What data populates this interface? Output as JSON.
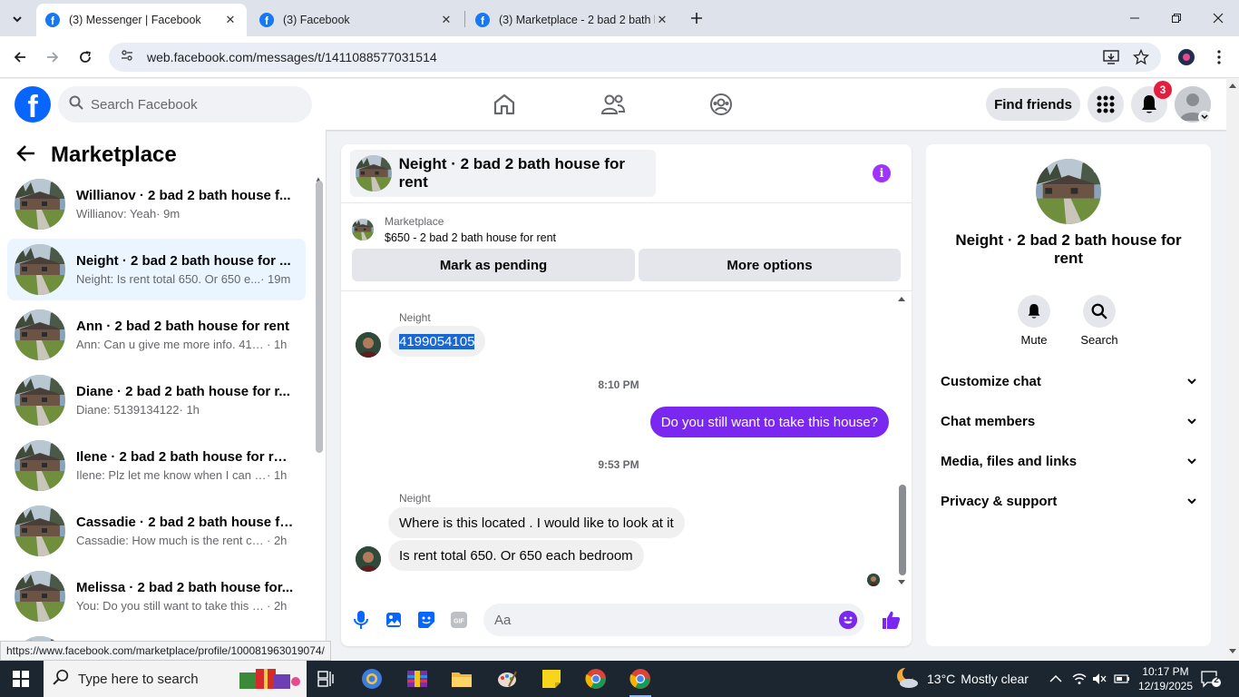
{
  "browser": {
    "tabs": [
      {
        "title": "(3) Messenger | Facebook",
        "active": true
      },
      {
        "title": "(3) Facebook",
        "active": false
      },
      {
        "title": "(3) Marketplace - 2 bad 2 bath house",
        "active": false
      }
    ],
    "url": "web.facebook.com/messages/t/1411088577031514",
    "status_url": "https://www.facebook.com/marketplace/profile/100081963019074/"
  },
  "fb_header": {
    "logo_letter": "f",
    "search_placeholder": "Search Facebook",
    "find_friends": "Find friends",
    "notification_count": "3"
  },
  "sidebar": {
    "title": "Marketplace",
    "conversations": [
      {
        "name": "Willianov · 2 bad 2 bath house f...",
        "preview": "Willianov: Yeah",
        "time": "· 9m"
      },
      {
        "name": "Neight · 2 bad 2 bath house for ...",
        "preview": "Neight: Is rent total 650. Or 650 e...",
        "time": "· 19m",
        "selected": true
      },
      {
        "name": "Ann · 2 bad 2 bath house for rent",
        "preview": "Ann: Can u give me more info. 419...",
        "time": "· 1h"
      },
      {
        "name": "Diane · 2 bad 2 bath house for r...",
        "preview": "Diane: 5139134122",
        "time": "· 1h"
      },
      {
        "name": "Ilene · 2 bad 2 bath house for rent",
        "preview": "Ilene: Plz let me know when I can c...",
        "time": "· 1h"
      },
      {
        "name": "Cassadie · 2 bad 2 bath house fo...",
        "preview": "Cassadie: How much is the rent cau...",
        "time": "· 2h"
      },
      {
        "name": "Melissa · 2 bad 2 bath house for...",
        "preview": "You: Do you still want to take this h...",
        "time": "· 2h"
      }
    ]
  },
  "chat": {
    "title": "Neight · 2 bad 2 bath house for rent",
    "marketplace_label": "Marketplace",
    "listing": "$650 - 2 bad 2 bath house for rent",
    "mark_pending": "Mark as pending",
    "more_options": "More options",
    "messages": {
      "sender1": "Neight",
      "msg1": "4199054105",
      "time1": "8:10 PM",
      "msg_out": "Do you still want to take this house?",
      "time2": "9:53 PM",
      "sender2": "Neight",
      "msg2": "Where is this located . I would like to look at it",
      "msg3": "Is rent total 650. Or 650 each bedroom"
    },
    "composer_placeholder": "Aa",
    "gif_label": "GIF"
  },
  "info_panel": {
    "title": "Neight · 2 bad 2 bath house for rent",
    "mute": "Mute",
    "search": "Search",
    "sections": [
      "Customize chat",
      "Chat members",
      "Media, files and links",
      "Privacy & support"
    ]
  },
  "taskbar": {
    "search_placeholder": "Type here to search",
    "temperature": "13°C",
    "weather": "Mostly clear",
    "time": "10:17 PM",
    "date": "12/19/2025",
    "notifications": "2"
  },
  "colors": {
    "fb_blue": "#0866ff",
    "messenger_purple": "#7a28f0",
    "selection_blue": "#1a66d2",
    "notif_red": "#e41e3f"
  }
}
